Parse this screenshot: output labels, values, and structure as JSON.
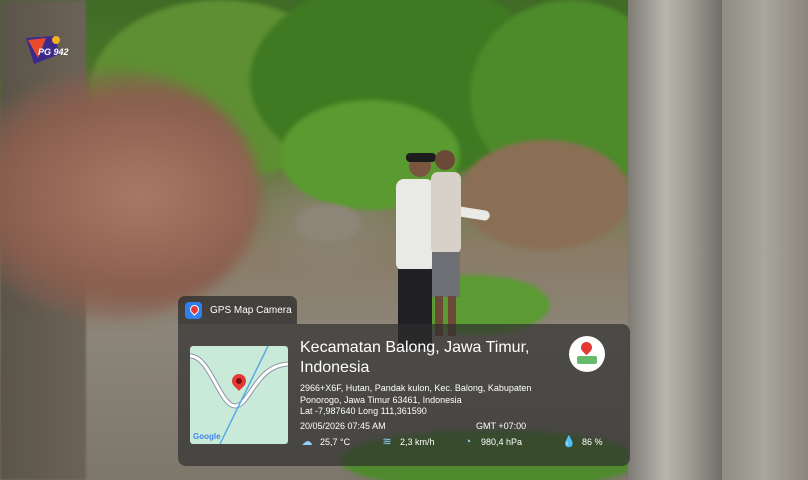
{
  "overlay": {
    "logo_text": "PG 942",
    "app_name": "GPS Map Camera",
    "place_title": "Kecamatan Balong, Jawa Timur, Indonesia",
    "address": "2966+X6F, Hutan, Pandak kulon, Kec. Balong, Kabupaten Ponorogo, Jawa Timur 63461, Indonesia",
    "lat_long": "Lat -7,987640 Long 111,361590",
    "datetime": "20/05/2026 07:45 AM",
    "gmt": "GMT +07:00",
    "map_brand": "Google",
    "weather": {
      "temperature": "25,7 °C",
      "wind": "2,3 km/h",
      "pressure": "980,4 hPa",
      "humidity": "86 %"
    },
    "icons": [
      "gps-map-camera-icon",
      "map-pin-icon",
      "location-marker-badge-icon",
      "thermometer-cloud-icon",
      "wind-icon",
      "pressure-gauge-icon",
      "humidity-drop-icon"
    ]
  },
  "colors": {
    "pin": "#e53935",
    "map_bg": "#c9ead8",
    "card_bg": "rgba(45,45,45,0.68)"
  }
}
